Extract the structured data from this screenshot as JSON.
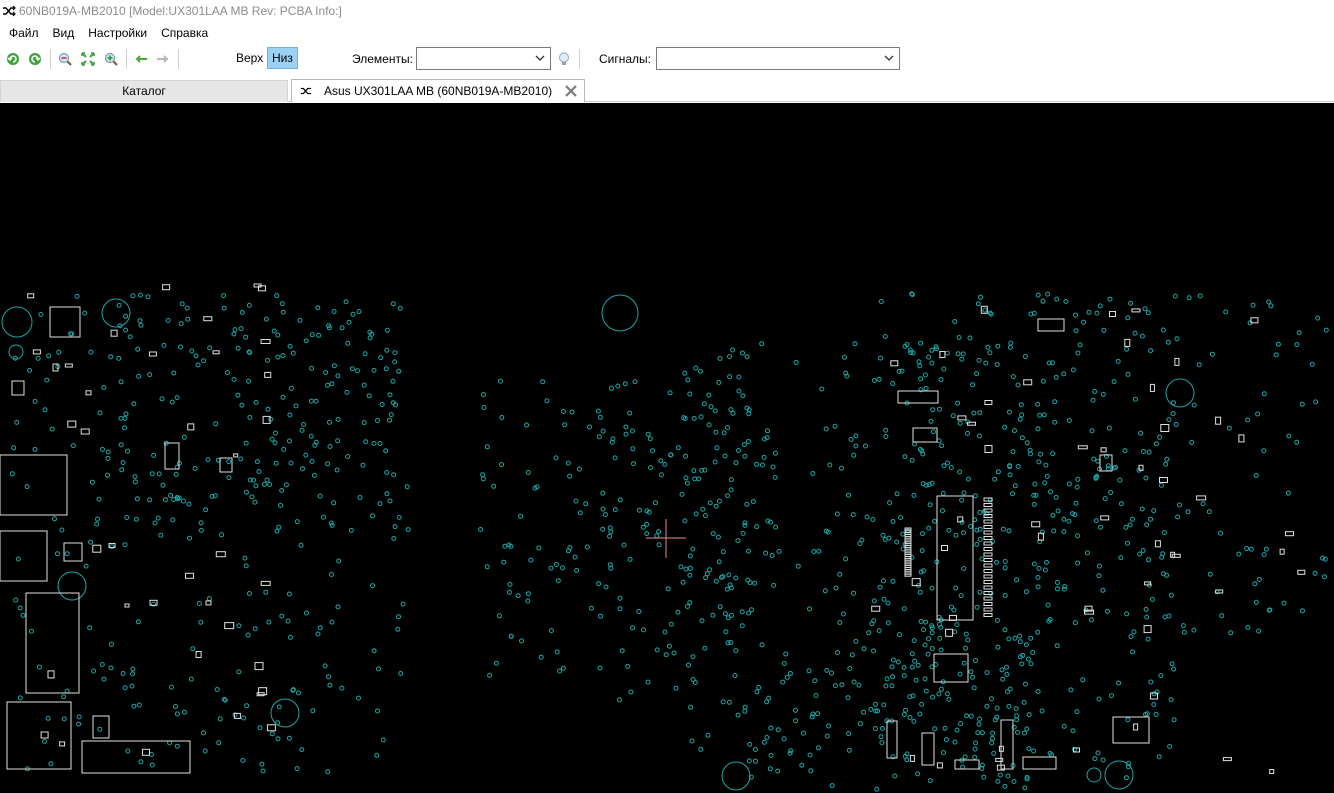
{
  "window": {
    "title": "60NB019A-MB2010 [Model:UX301LAA MB Rev: PCBA Info:]",
    "icon": "shuffle-icon"
  },
  "menu": {
    "items": [
      "Файл",
      "Вид",
      "Настройки",
      "Справка"
    ]
  },
  "toolbar": {
    "buttons": [
      "rotate-left-icon",
      "rotate-right-icon",
      "zoom-out-icon",
      "fit-icon",
      "zoom-in-icon",
      "back-arrow-icon",
      "forward-arrow-icon"
    ],
    "layer_top": "Верх",
    "layer_bottom": "Низ",
    "active_layer": "Низ",
    "elements_label": "Элементы:",
    "elements_value": "",
    "signals_label": "Сигналы:",
    "signals_value": ""
  },
  "tabs": {
    "catalog": "Каталог",
    "board": "Asus UX301LAA MB (60NB019A-MB2010)"
  },
  "colors": {
    "canvas": "#000000",
    "pins": "#1aa6a6",
    "outlines": "#e0e0e0",
    "cursor": "#c0707a",
    "active_layer": "#9dd0f5"
  }
}
